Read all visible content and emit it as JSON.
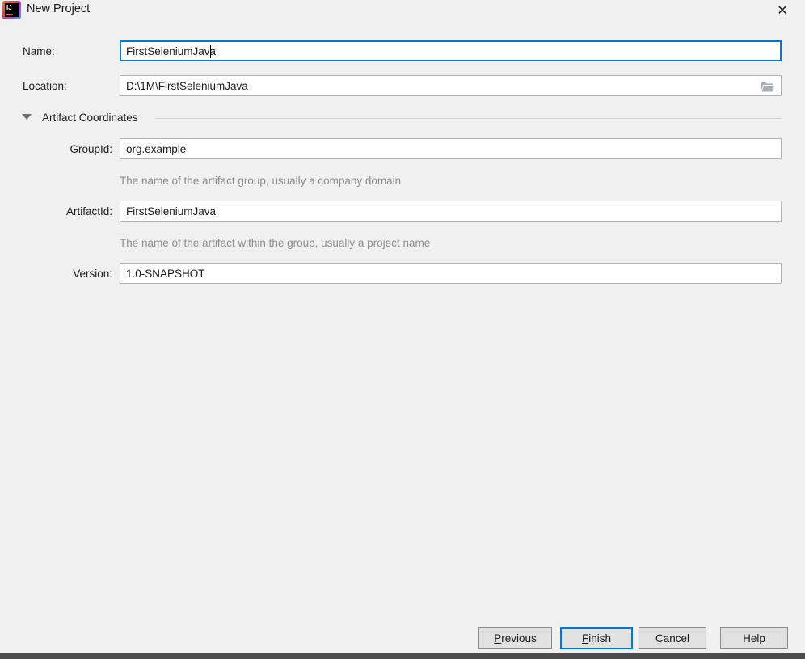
{
  "colors": {
    "accent": "#0078d7",
    "dialog_background": "#f0f0f0",
    "field_border": "#b3b3b3",
    "hint_text": "#8c8c8c"
  },
  "titlebar": {
    "title": "New Project",
    "logo_text": "IJ",
    "close_icon": "✕"
  },
  "form": {
    "name": {
      "label": "Name:",
      "value": "FirstSeleniumJava"
    },
    "location": {
      "label": "Location:",
      "value": "D:\\1M\\FirstSeleniumJava",
      "browse_icon": "folder"
    },
    "artifact_section": {
      "title": "Artifact Coordinates"
    },
    "group_id": {
      "label": "GroupId:",
      "value": "org.example",
      "hint": "The name of the artifact group, usually a company domain"
    },
    "artifact_id": {
      "label": "ArtifactId:",
      "value": "FirstSeleniumJava",
      "hint": "The name of the artifact within the group, usually a project name"
    },
    "version": {
      "label": "Version:",
      "value": "1.0-SNAPSHOT"
    }
  },
  "buttons": {
    "previous": "Previous",
    "finish": "Finish",
    "cancel": "Cancel",
    "help": "Help"
  }
}
